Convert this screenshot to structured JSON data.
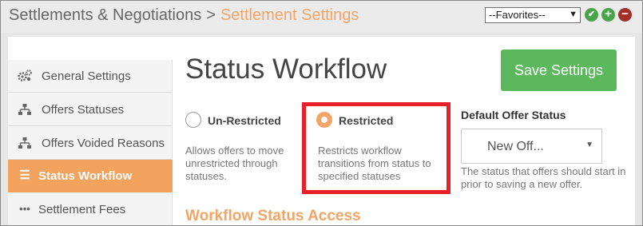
{
  "header": {
    "breadcrumb_parent": "Settlements & Negotiations",
    "breadcrumb_separator": ">",
    "breadcrumb_current": "Settlement Settings",
    "favorites_value": "--Favorites--"
  },
  "sidebar": {
    "items": [
      {
        "label": "General Settings",
        "icon": "gears-icon"
      },
      {
        "label": "Offers Statuses",
        "icon": "sitemap-icon"
      },
      {
        "label": "Offers Voided Reasons",
        "icon": "sitemap-icon"
      },
      {
        "label": "Status Workflow",
        "icon": "list-icon",
        "active": true
      },
      {
        "label": "Settlement Fees",
        "icon": "ellipsis-icon"
      }
    ]
  },
  "main": {
    "title": "Status Workflow",
    "save_label": "Save Settings",
    "options": [
      {
        "label": "Un-Restricted",
        "description": "Allows offers to move unrestricted through statuses.",
        "selected": false
      },
      {
        "label": "Restricted",
        "description": "Restricts workflow transitions from status to specified statuses",
        "selected": true
      }
    ],
    "default_offer_status": {
      "label": "Default Offer Status",
      "value": "New Off...",
      "help": "The status that offers should start in prior to saving a new offer."
    },
    "section_heading": "Workflow Status Access"
  },
  "colors": {
    "accent": "#f3a568",
    "save_button": "#5cb85c",
    "highlight_border": "#e8202a"
  }
}
